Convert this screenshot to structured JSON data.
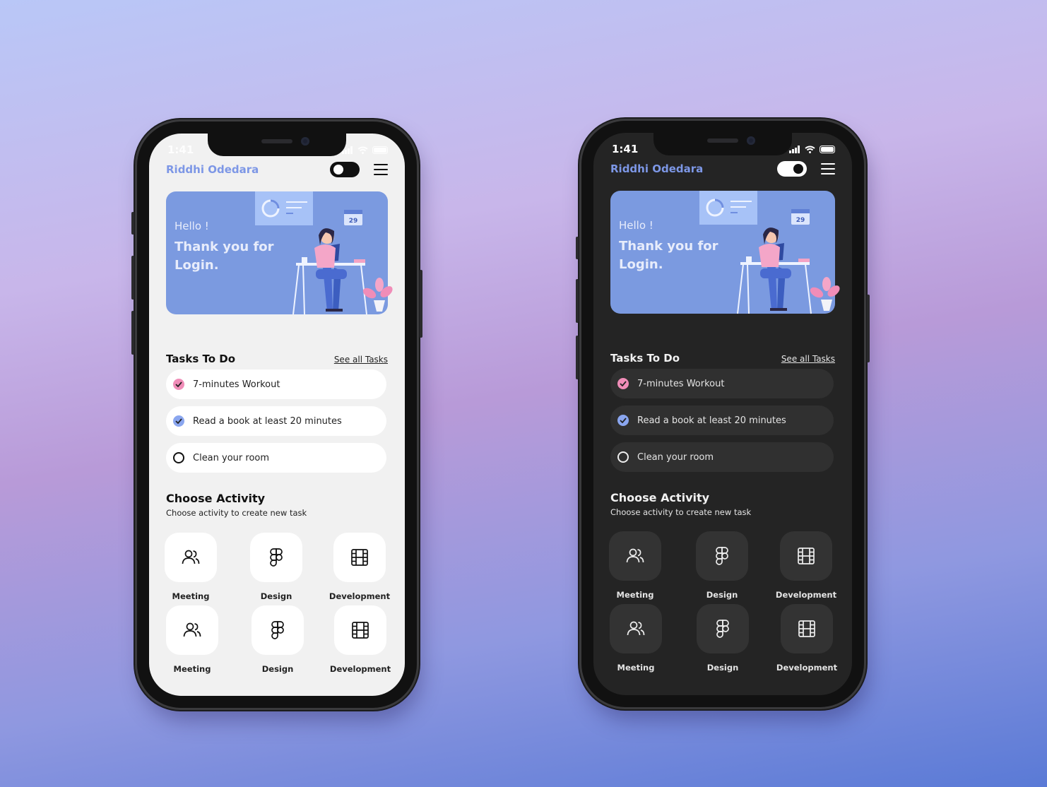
{
  "colors": {
    "accent_blue": "#7d97e6",
    "hero_bg": "#7b9ae0",
    "check_pink": "#f08db8",
    "check_blue": "#8aa6ef",
    "light_bg": "#f1f1f1",
    "dark_bg": "#242424"
  },
  "phones": [
    {
      "theme": "light",
      "status": {
        "time": "1:41",
        "icons": [
          "signal-icon",
          "wifi-icon",
          "battery-icon"
        ]
      },
      "header": {
        "user_name": "Riddhi Odedara",
        "toggle_state": "off",
        "menu_icon": "menu-icon"
      },
      "hero": {
        "greeting": "Hello !",
        "message": "Thank you for Login.",
        "calendar_day": "29"
      },
      "tasks": {
        "title": "Tasks To Do",
        "see_all": "See all Tasks",
        "items": [
          {
            "label": "7-minutes Workout",
            "state": "checked-pink"
          },
          {
            "label": "Read a book at least 20 minutes",
            "state": "checked-blue"
          },
          {
            "label": "Clean your room",
            "state": "unchecked"
          }
        ]
      },
      "activity": {
        "title": "Choose Activity",
        "subtitle": "Choose activity to create new task",
        "tiles": [
          {
            "label": "Meeting",
            "icon": "users-icon"
          },
          {
            "label": "Design",
            "icon": "figma-icon"
          },
          {
            "label": "Development",
            "icon": "film-icon"
          },
          {
            "label": "Meeting",
            "icon": "users-icon"
          },
          {
            "label": "Design",
            "icon": "figma-icon"
          },
          {
            "label": "Development",
            "icon": "film-icon"
          }
        ]
      }
    },
    {
      "theme": "dark",
      "status": {
        "time": "1:41",
        "icons": [
          "signal-icon",
          "wifi-icon",
          "battery-icon"
        ]
      },
      "header": {
        "user_name": "Riddhi Odedara",
        "toggle_state": "on",
        "menu_icon": "menu-icon"
      },
      "hero": {
        "greeting": "Hello !",
        "message": "Thank you for Login.",
        "calendar_day": "29"
      },
      "tasks": {
        "title": "Tasks To Do",
        "see_all": "See all Tasks",
        "items": [
          {
            "label": "7-minutes Workout",
            "state": "checked-pink"
          },
          {
            "label": "Read a book at least 20 minutes",
            "state": "checked-blue"
          },
          {
            "label": "Clean your room",
            "state": "unchecked"
          }
        ]
      },
      "activity": {
        "title": "Choose Activity",
        "subtitle": "Choose activity to create new task",
        "tiles": [
          {
            "label": "Meeting",
            "icon": "users-icon"
          },
          {
            "label": "Design",
            "icon": "figma-icon"
          },
          {
            "label": "Development",
            "icon": "film-icon"
          },
          {
            "label": "Meeting",
            "icon": "users-icon"
          },
          {
            "label": "Design",
            "icon": "figma-icon"
          },
          {
            "label": "Development",
            "icon": "film-icon"
          }
        ]
      }
    }
  ]
}
